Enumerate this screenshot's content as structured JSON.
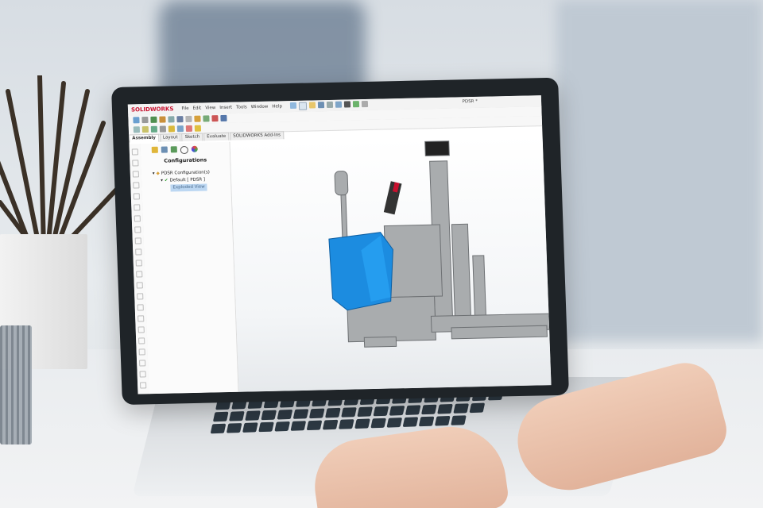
{
  "app": {
    "name": "SOLIDWORKS",
    "document_title": "PDSR *"
  },
  "menu": [
    "File",
    "Edit",
    "View",
    "Insert",
    "Tools",
    "Window",
    "Help"
  ],
  "command_tabs": [
    "Assembly",
    "Layout",
    "Sketch",
    "Evaluate",
    "SOLIDWORKS Add-Ins"
  ],
  "panel": {
    "title": "Configurations",
    "tree": {
      "root": "PDSR Configuration(s)",
      "child": "Default [ PDSR ]",
      "sub": "Exploded View"
    }
  },
  "colors": {
    "brand_red": "#c8102e",
    "model_blue": "#1c8ce0",
    "model_grey": "#a9acae",
    "selection": "#bcd7f2"
  },
  "icons": [
    "home-icon",
    "new-file-icon",
    "open-icon",
    "save-icon",
    "print-icon",
    "undo-icon",
    "select-icon",
    "rebuild-icon",
    "options-icon"
  ]
}
